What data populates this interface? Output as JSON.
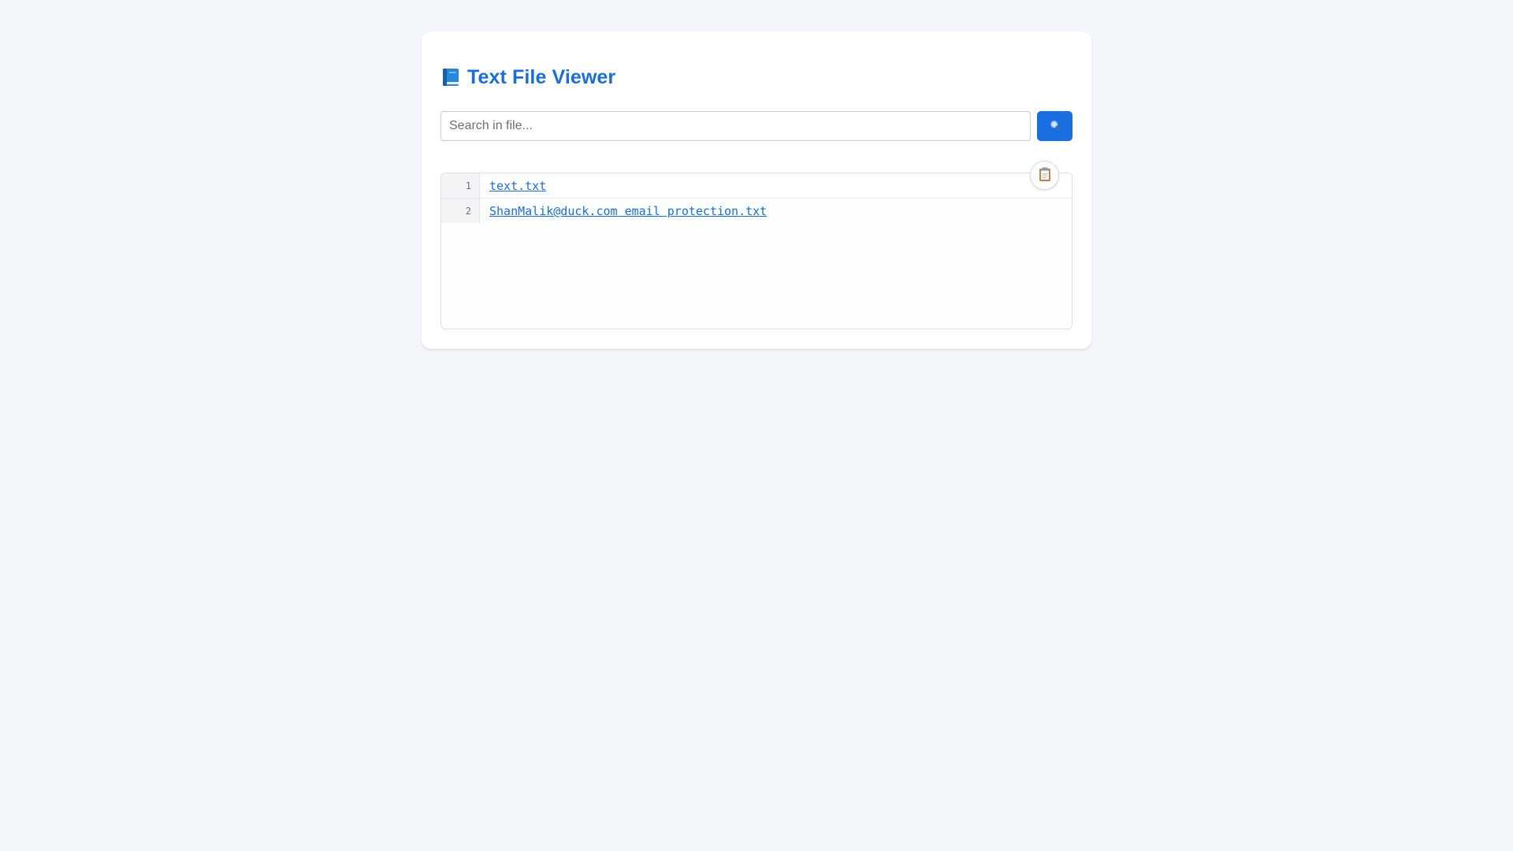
{
  "app": {
    "title": "Text File Viewer",
    "title_icon": "book-icon"
  },
  "search": {
    "placeholder": "Search in file...",
    "value": "",
    "button_icon": "magnifier-icon"
  },
  "viewer": {
    "copy_icon": "clipboard-icon",
    "lines": [
      {
        "number": "1",
        "text": "text.txt"
      },
      {
        "number": "2",
        "text": "ShanMalik@duck.com email protection.txt"
      }
    ]
  },
  "colors": {
    "accent": "#1a6fd6",
    "button": "#1a6fe0",
    "background": "#f3f6fa"
  }
}
